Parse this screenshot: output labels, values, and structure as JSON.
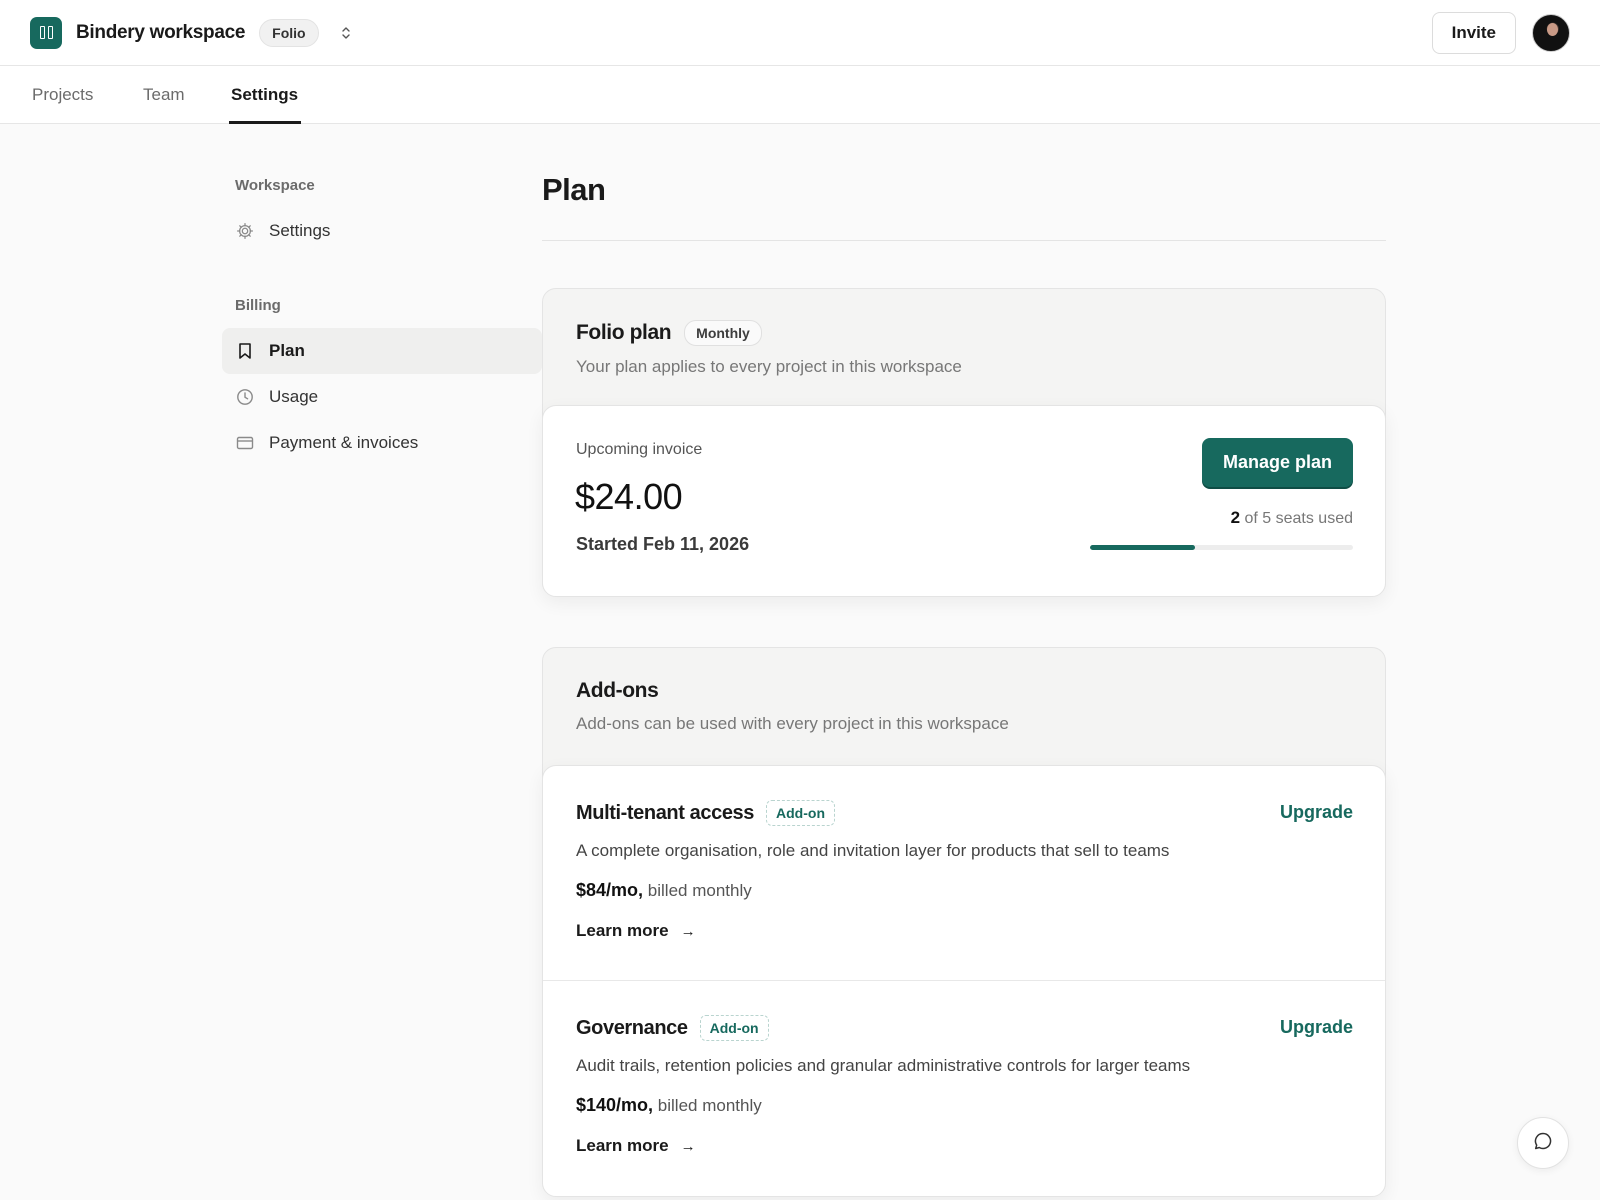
{
  "header": {
    "workspace_name": "Bindery workspace",
    "plan_pill": "Folio",
    "invite_label": "Invite"
  },
  "tabs": [
    {
      "label": "Projects",
      "active": false
    },
    {
      "label": "Team",
      "active": false
    },
    {
      "label": "Settings",
      "active": true
    }
  ],
  "sidebar": {
    "workspace_heading": "Workspace",
    "workspace_items": [
      {
        "label": "Settings",
        "icon": "gear-icon"
      }
    ],
    "billing_heading": "Billing",
    "billing_items": [
      {
        "label": "Plan",
        "icon": "bookmark-icon",
        "active": true
      },
      {
        "label": "Usage",
        "icon": "clock-icon",
        "active": false
      },
      {
        "label": "Payment & invoices",
        "icon": "credit-card-icon",
        "active": false
      }
    ]
  },
  "main": {
    "title": "Plan",
    "plan_card": {
      "title": "Folio plan",
      "badge": "Monthly",
      "subtitle": "Your plan applies to every project in this workspace",
      "invoice_label": "Upcoming invoice",
      "invoice_amount": "$24.00",
      "started": "Started Feb 11, 2026",
      "manage_label": "Manage plan",
      "seats_used": "2",
      "seats_text": "of 5 seats used",
      "seats_fraction": 0.4
    },
    "addons_card": {
      "title": "Add-ons",
      "subtitle": "Add-ons can be used with every project in this workspace",
      "items": [
        {
          "title": "Multi-tenant access",
          "badge": "Add-on",
          "upgrade_label": "Upgrade",
          "description": "A complete organisation, role and invitation layer for products that sell to teams",
          "price": "$84/mo,",
          "billing": "billed monthly",
          "learn_more": "Learn more"
        },
        {
          "title": "Governance",
          "badge": "Add-on",
          "upgrade_label": "Upgrade",
          "description": "Audit trails, retention policies and granular administrative controls for larger teams",
          "price": "$140/mo,",
          "billing": "billed monthly",
          "learn_more": "Learn more"
        }
      ]
    }
  },
  "colors": {
    "accent": "#17695e",
    "page_bg": "#fafafa"
  }
}
